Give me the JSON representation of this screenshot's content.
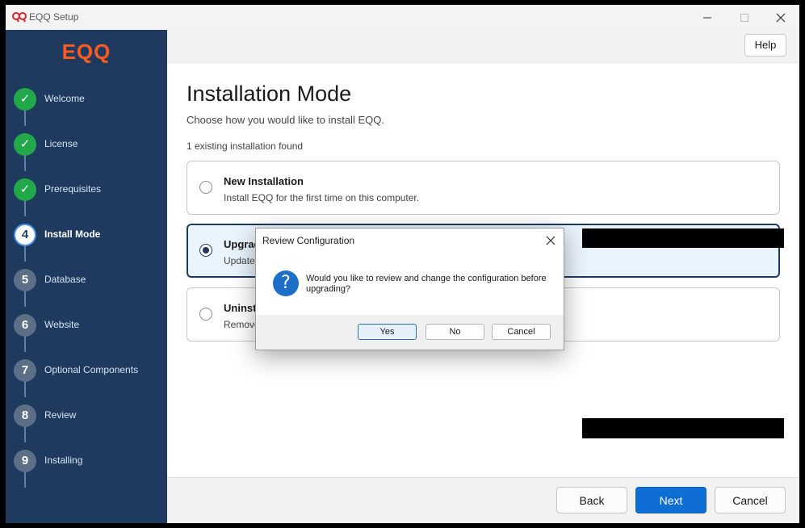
{
  "window": {
    "title": "EQQ Setup"
  },
  "sidebar": {
    "logo": "EQQ",
    "steps": [
      {
        "number": "✓",
        "label": "Welcome",
        "state": "done"
      },
      {
        "number": "✓",
        "label": "License",
        "state": "done"
      },
      {
        "number": "✓",
        "label": "Prerequisites",
        "state": "done"
      },
      {
        "number": "4",
        "label": "Install Mode",
        "state": "active"
      },
      {
        "number": "5",
        "label": "Database",
        "state": "todo"
      },
      {
        "number": "6",
        "label": "Website",
        "state": "todo"
      },
      {
        "number": "7",
        "label": "Optional Components",
        "state": "todo"
      },
      {
        "number": "8",
        "label": "Review",
        "state": "todo"
      },
      {
        "number": "9",
        "label": "Installing",
        "state": "todo"
      }
    ]
  },
  "header": {
    "help_label": "Help"
  },
  "main": {
    "title": "Installation Mode",
    "subtitle": "Choose how you would like to install EQQ.",
    "found_text": "1 existing installation found",
    "options": [
      {
        "title": "New Installation",
        "description": "Install EQQ for the first time on this computer.",
        "selected": false
      },
      {
        "title": "Upgrad",
        "description": "Update",
        "selected": true
      },
      {
        "title": "Uninsta",
        "description": "Remove",
        "selected": false
      }
    ]
  },
  "footer": {
    "back_label": "Back",
    "next_label": "Next",
    "cancel_label": "Cancel"
  },
  "dialog": {
    "title": "Review Configuration",
    "message": "Would you like to review and change the configuration before upgrading?",
    "yes_label": "Yes",
    "no_label": "No",
    "cancel_label": "Cancel",
    "icon": "question-icon"
  },
  "colors": {
    "sidebar": "#1e3a5f",
    "logo": "#ff5a1f",
    "step_done": "#22a84a",
    "primary": "#0f6ed3"
  }
}
